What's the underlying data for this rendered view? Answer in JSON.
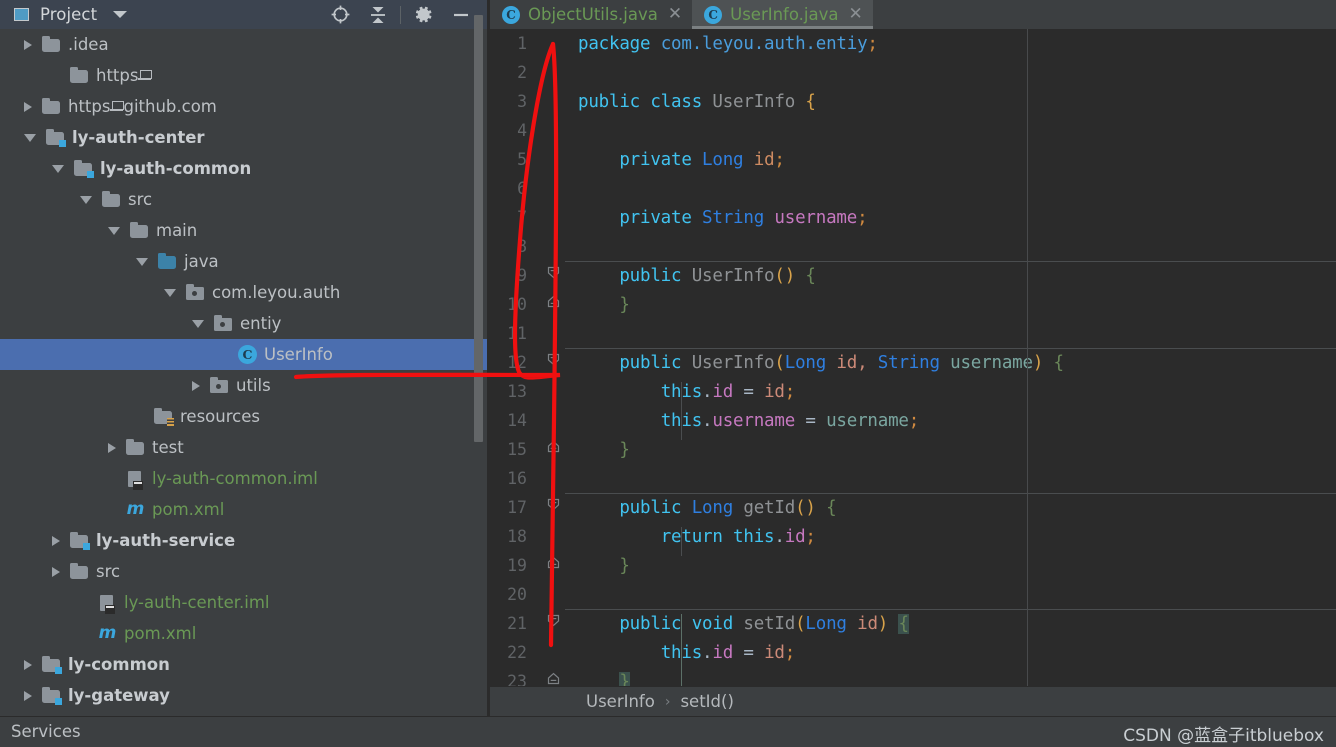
{
  "project_panel": {
    "title": "Project",
    "caret_icon": "chevron-down-icon",
    "tools": [
      {
        "name": "locate-target-icon",
        "label": "Select Opened File"
      },
      {
        "name": "collapse-all-icon",
        "label": "Collapse All"
      },
      {
        "name": "gear-icon",
        "label": "Settings"
      },
      {
        "name": "minimize-icon",
        "label": "Hide"
      }
    ],
    "tree": [
      {
        "label": ".idea",
        "indent": 1,
        "arrow": "closed",
        "icon": "folder",
        "style": "plain"
      },
      {
        "label": "https",
        "indent": 2,
        "arrow": "none",
        "icon": "folder",
        "style": "plain",
        "suffix": "laptop"
      },
      {
        "label": "https",
        "indent": 1,
        "arrow": "closed",
        "icon": "folder",
        "style": "plain",
        "suffix": "laptop",
        "tail": "github.com"
      },
      {
        "label": "ly-auth-center",
        "indent": 1,
        "arrow": "open",
        "icon": "folder-module",
        "style": "bold"
      },
      {
        "label": "ly-auth-common",
        "indent": 2,
        "arrow": "open",
        "icon": "folder-module",
        "style": "bold"
      },
      {
        "label": "src",
        "indent": 3,
        "arrow": "open",
        "icon": "folder",
        "style": "plain"
      },
      {
        "label": "main",
        "indent": 4,
        "arrow": "open",
        "icon": "folder",
        "style": "plain"
      },
      {
        "label": "java",
        "indent": 5,
        "arrow": "open",
        "icon": "folder-source",
        "style": "plain"
      },
      {
        "label": "com.leyou.auth",
        "indent": 6,
        "arrow": "open",
        "icon": "package",
        "style": "plain"
      },
      {
        "label": "entiy",
        "indent": 7,
        "arrow": "open",
        "icon": "package",
        "style": "plain"
      },
      {
        "label": "UserInfo",
        "indent": 8,
        "arrow": "none",
        "icon": "class",
        "style": "plain",
        "selected": true
      },
      {
        "label": "utils",
        "indent": 7,
        "arrow": "closed",
        "icon": "package",
        "style": "plain"
      },
      {
        "label": "resources",
        "indent": 5,
        "arrow": "none",
        "icon": "folder-resources",
        "style": "plain"
      },
      {
        "label": "test",
        "indent": 4,
        "arrow": "closed",
        "icon": "folder",
        "style": "plain"
      },
      {
        "label": "ly-auth-common.iml",
        "indent": 4,
        "arrow": "none",
        "icon": "iml",
        "style": "green"
      },
      {
        "label": "pom.xml",
        "indent": 4,
        "arrow": "none",
        "icon": "maven",
        "style": "green"
      },
      {
        "label": "ly-auth-service",
        "indent": 2,
        "arrow": "closed",
        "icon": "folder-module",
        "style": "bold"
      },
      {
        "label": "src",
        "indent": 2,
        "arrow": "closed",
        "icon": "folder",
        "style": "plain"
      },
      {
        "label": "ly-auth-center.iml",
        "indent": 3,
        "arrow": "none",
        "icon": "iml",
        "style": "green"
      },
      {
        "label": "pom.xml",
        "indent": 3,
        "arrow": "none",
        "icon": "maven",
        "style": "green"
      },
      {
        "label": "ly-common",
        "indent": 1,
        "arrow": "closed",
        "icon": "folder-module",
        "style": "bold"
      },
      {
        "label": "ly-gateway",
        "indent": 1,
        "arrow": "closed",
        "icon": "folder-module",
        "style": "bold"
      }
    ]
  },
  "editor": {
    "tabs": [
      {
        "label": "ObjectUtils.java",
        "icon": "class-icon",
        "active": false,
        "close_icon": "close-icon"
      },
      {
        "label": "UserInfo.java",
        "icon": "class-icon",
        "active": true,
        "close_icon": "close-icon"
      }
    ],
    "lines": [
      {
        "n": "1",
        "fold": "",
        "sep": false,
        "guide": 0,
        "html": "<span class='k'>package</span> <span class='pkgc'>com.leyou.auth.entiy</span><span class='sem'>;</span>"
      },
      {
        "n": "2",
        "fold": "",
        "sep": false,
        "guide": 0,
        "html": ""
      },
      {
        "n": "3",
        "fold": "",
        "sep": false,
        "guide": 0,
        "html": "<span class='k'>public class</span> <span class='cls'>UserInfo</span> <span class='br'>{</span>"
      },
      {
        "n": "4",
        "fold": "",
        "sep": false,
        "guide": 0,
        "html": ""
      },
      {
        "n": "5",
        "fold": "",
        "sep": false,
        "guide": 0,
        "html": "    <span class='k'>private</span> <span class='typ'>Long</span> <span class='fldo'>id</span><span class='sem'>;</span>"
      },
      {
        "n": "6",
        "fold": "",
        "sep": false,
        "guide": 0,
        "html": ""
      },
      {
        "n": "7",
        "fold": "",
        "sep": false,
        "guide": 0,
        "html": "    <span class='k'>private</span> <span class='typ'>String</span> <span class='fld'>username</span><span class='sem'>;</span>"
      },
      {
        "n": "8",
        "fold": "",
        "sep": false,
        "guide": 0,
        "html": ""
      },
      {
        "n": "9",
        "fold": "open",
        "sep": true,
        "guide": 0,
        "html": "    <span class='k'>public</span> <span class='cls'>UserInfo</span><span class='br'>()</span> <span class='brg'>{</span>"
      },
      {
        "n": "10",
        "fold": "end",
        "sep": false,
        "guide": 0,
        "html": "    <span class='brg'>}</span>"
      },
      {
        "n": "11",
        "fold": "",
        "sep": false,
        "guide": 0,
        "html": ""
      },
      {
        "n": "12",
        "fold": "open",
        "sep": true,
        "guide": 0,
        "html": "    <span class='k'>public</span> <span class='cls'>UserInfo</span><span class='br'>(</span><span class='typ'>Long</span> <span class='par'>id</span><span class='par'>,</span> <span class='typ'>String</span> <span class='par2'>username</span><span class='br'>)</span> <span class='brg'>{</span>"
      },
      {
        "n": "13",
        "fold": "",
        "sep": false,
        "guide": 1,
        "html": "        <span class='k'>this</span>.<span class='fld'>id</span> = <span class='par'>id</span><span class='sem'>;</span>"
      },
      {
        "n": "14",
        "fold": "",
        "sep": false,
        "guide": 1,
        "html": "        <span class='k'>this</span>.<span class='fld'>username</span> = <span class='par2'>username</span><span class='sem'>;</span>"
      },
      {
        "n": "15",
        "fold": "end",
        "sep": false,
        "guide": 0,
        "html": "    <span class='brg'>}</span>"
      },
      {
        "n": "16",
        "fold": "",
        "sep": false,
        "guide": 0,
        "html": ""
      },
      {
        "n": "17",
        "fold": "open",
        "sep": true,
        "guide": 0,
        "html": "    <span class='k'>public</span> <span class='typ'>Long</span> <span class='cls'>getId</span><span class='br'>()</span> <span class='brg'>{</span>"
      },
      {
        "n": "18",
        "fold": "",
        "sep": false,
        "guide": 1,
        "html": "        <span class='k'>return this</span>.<span class='fld'>id</span><span class='sem'>;</span>"
      },
      {
        "n": "19",
        "fold": "end",
        "sep": false,
        "guide": 0,
        "html": "    <span class='brg'>}</span>"
      },
      {
        "n": "20",
        "fold": "",
        "sep": false,
        "guide": 0,
        "html": ""
      },
      {
        "n": "21",
        "fold": "open",
        "sep": true,
        "guide": 2,
        "html": "    <span class='k'>public</span> <span class='k'>void</span> <span class='cls'>setId</span><span class='br'>(</span><span class='typ'>Long</span> <span class='par'>id</span><span class='br'>)</span> <span class='brg hl'>{</span>"
      },
      {
        "n": "22",
        "fold": "",
        "sep": false,
        "guide": 2,
        "html": "        <span class='k'>this</span>.<span class='fld'>id</span> = <span class='par'>id</span><span class='sem'>;</span>"
      },
      {
        "n": "23",
        "fold": "end",
        "sep": false,
        "guide": 2,
        "html": "    <span class='brg hl'>}</span>"
      }
    ],
    "breadcrumb": [
      "UserInfo",
      "setId()"
    ],
    "breadcrumb_separator": "›"
  },
  "status_bar": {
    "services_label": "Services",
    "watermark": "CSDN @蓝盒子itbluebox"
  },
  "annotation": {
    "name": "red-ink-annotation",
    "color": "#f01010"
  },
  "colors": {
    "panel_bg": "#3c3f41",
    "editor_bg": "#2b2b2b",
    "selection": "#4b6eaf",
    "accent": "#3ba7dd",
    "tab_text": "#6a9955"
  }
}
